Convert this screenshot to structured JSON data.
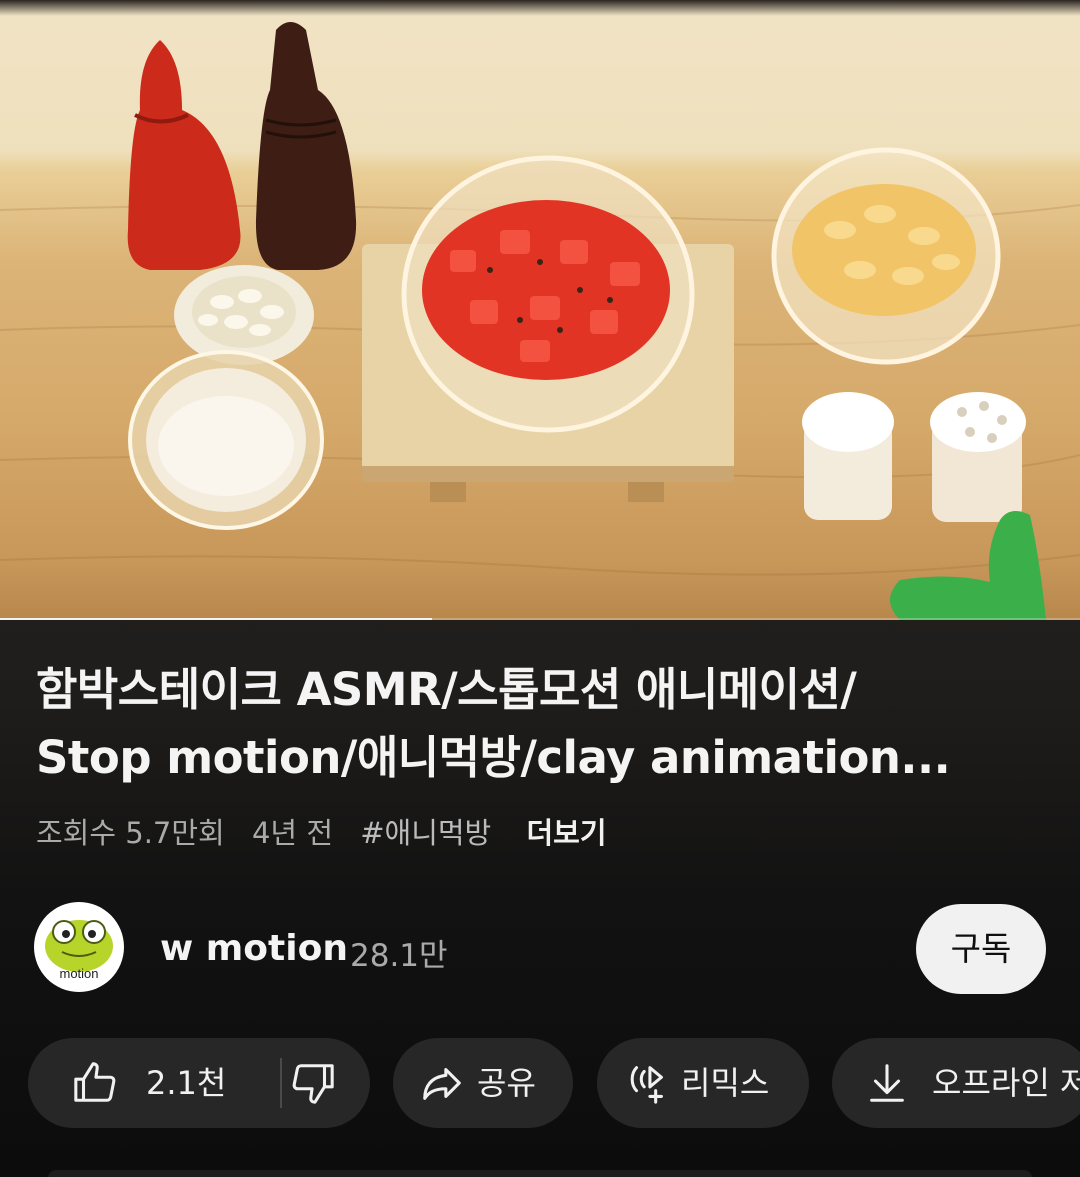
{
  "video": {
    "progress_fraction": 0.4
  },
  "title": {
    "line1": "함박스테이크 ASMR/스톱모션 애니메이션/",
    "line2": "Stop motion/애니먹방/clay animation..."
  },
  "meta": {
    "views": "조회수 5.7만회",
    "age": "4년 전",
    "hashtag": "#애니먹방",
    "more": "더보기"
  },
  "channel": {
    "avatar_text": "motion",
    "name": "w motion",
    "subscribers": "28.1만",
    "subscribe_label": "구독"
  },
  "actions": {
    "like_count": "2.1천",
    "share_label": "공유",
    "remix_label": "리믹스",
    "download_label": "오프라인 저"
  },
  "colors": {
    "background": "#0f0f0f",
    "chip": "#272727",
    "subscribe_button": "#f1f1f1"
  },
  "icons": [
    "thumbs-up-icon",
    "thumbs-down-icon",
    "share-arrow-icon",
    "remix-icon",
    "download-icon"
  ]
}
